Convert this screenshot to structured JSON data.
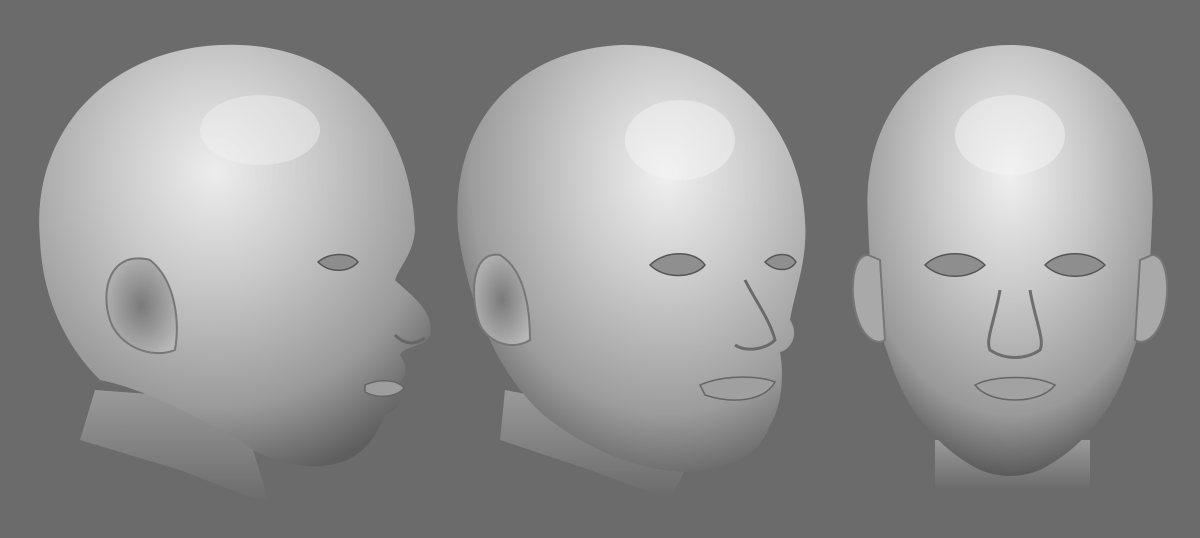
{
  "scene": {
    "background_color": "#6b6b6b",
    "material_color": "#b4b4b4",
    "highlight_color": "#eeeeee",
    "shadow_color": "#3c3c3c",
    "views": [
      {
        "id": "side",
        "angle": "profile-right"
      },
      {
        "id": "three-quarter",
        "angle": "three-quarter-right"
      },
      {
        "id": "front",
        "angle": "frontal"
      }
    ]
  }
}
